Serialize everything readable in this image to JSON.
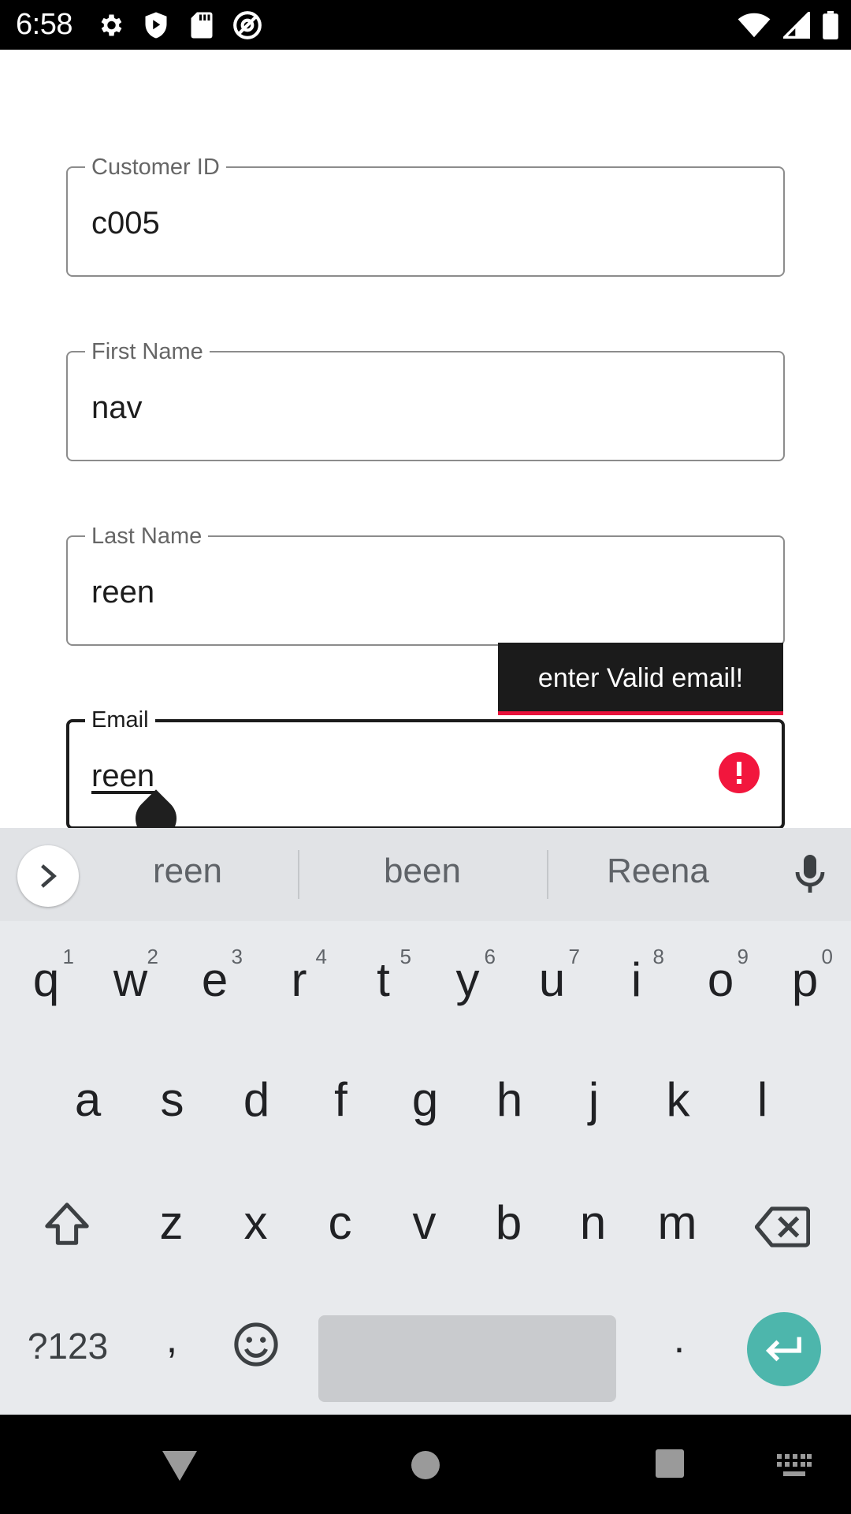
{
  "status_bar": {
    "time": "6:58",
    "left_icons": [
      "gear-icon",
      "play-protect-icon",
      "sd-card-icon",
      "at-sign-icon"
    ],
    "right_icons": [
      "wifi-icon",
      "cellular-signal-icon",
      "battery-icon"
    ]
  },
  "form": {
    "fields": [
      {
        "label": "Customer ID",
        "value": "c005"
      },
      {
        "label": "First Name",
        "value": "nav"
      },
      {
        "label": "Last Name",
        "value": "reen"
      },
      {
        "label": "Email",
        "value": "reen",
        "focused": true,
        "error": "enter Valid email!"
      }
    ]
  },
  "keyboard": {
    "suggestions": [
      "reen",
      "been",
      "Reena"
    ],
    "row1": [
      {
        "label": "q",
        "hint": "1"
      },
      {
        "label": "w",
        "hint": "2"
      },
      {
        "label": "e",
        "hint": "3"
      },
      {
        "label": "r",
        "hint": "4"
      },
      {
        "label": "t",
        "hint": "5"
      },
      {
        "label": "y",
        "hint": "6"
      },
      {
        "label": "u",
        "hint": "7"
      },
      {
        "label": "i",
        "hint": "8"
      },
      {
        "label": "o",
        "hint": "9"
      },
      {
        "label": "p",
        "hint": "0"
      }
    ],
    "row2": [
      "a",
      "s",
      "d",
      "f",
      "g",
      "h",
      "j",
      "k",
      "l"
    ],
    "row3": [
      "z",
      "x",
      "c",
      "v",
      "b",
      "n",
      "m"
    ],
    "symbols_label": "?123",
    "comma_label": ",",
    "period_label": ".",
    "enter_color": "#4db6ac"
  },
  "nav_bar": {
    "icons": [
      "back-triangle-icon",
      "home-circle-icon",
      "recents-square-icon",
      "keyboard-switch-icon"
    ]
  },
  "colors": {
    "error": "#f2163d",
    "field_border": "#8c8c8c",
    "focused_border": "#1c1c1c"
  }
}
